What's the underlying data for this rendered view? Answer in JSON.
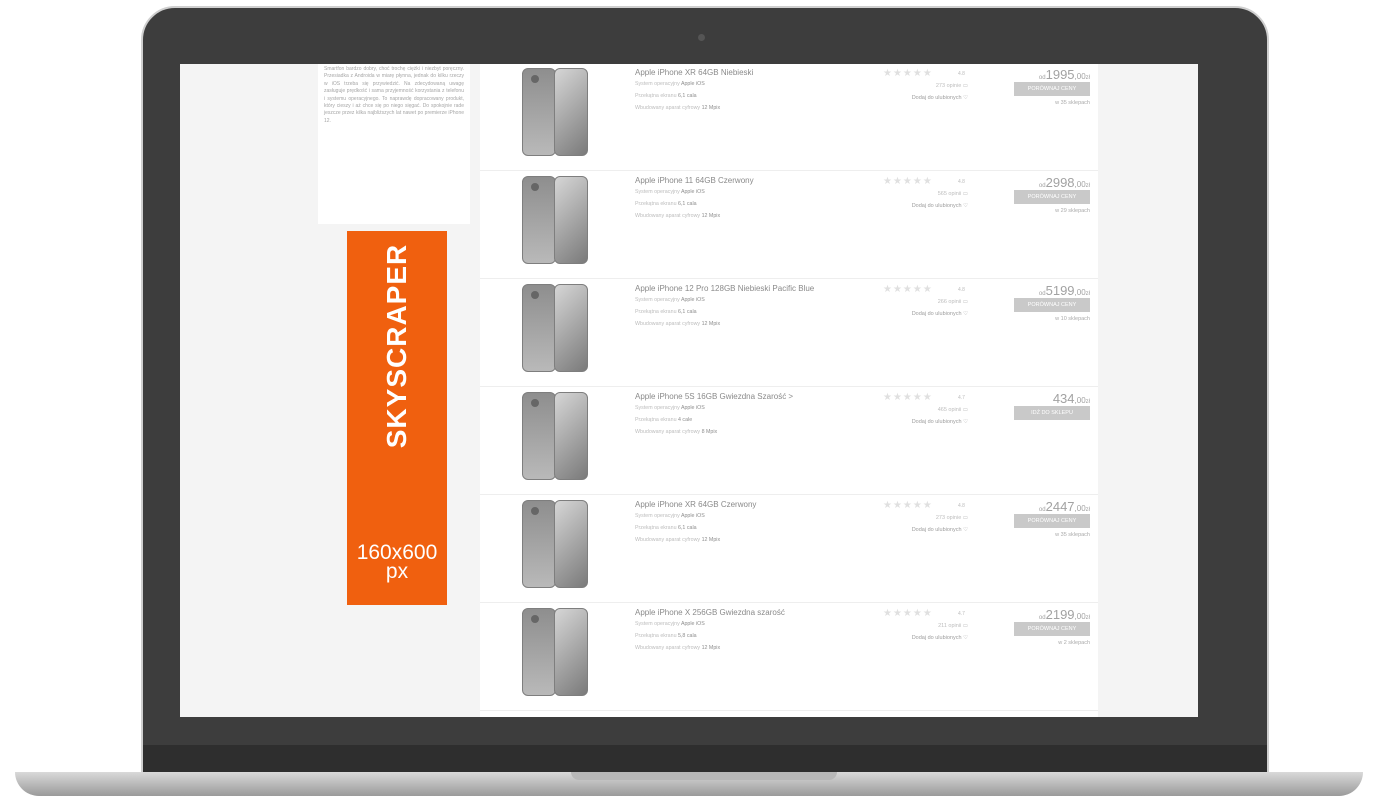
{
  "description": "Smartfon bardzo dobry, choć trochę ciężki i niezbyt poręczny. Przesiadka z Androida w miarę płynna, jednak do kilku rzeczy w iOS trzeba się przywiedzić. Na zdecydowaną uwagę zasługuje prędkość i sama przyjemność korzystania z telefonu i systemu operacyjnego. To naprawdę dopracowany produkt, który cieszy i aż chce się po niego sięgać. Do spokojnie rade jeszcze przez kilka najbliższych lat nawet po premierze iPhone 12.",
  "ad": {
    "title": "SKYSCRAPER",
    "size": "160x600",
    "unit": "px",
    "color": "#f0600f"
  },
  "labels": {
    "os": "System operacyjny",
    "screen": "Przekątna ekranu",
    "camera": "Wbudowany aparat cyfrowy",
    "favorite": "Dodaj do ulubionych"
  },
  "products": [
    {
      "name": "Apple iPhone XR 64GB Niebieski",
      "os": "Apple iOS",
      "screen": "6,1 cala",
      "camera": "12 Mpix",
      "rating": "4.8",
      "reviews": "273 opinie",
      "prefix": "od",
      "price": "1995",
      "decimals": ",00",
      "currency": "zł",
      "button": "PORÓWNAJ CENY",
      "shops": "w 35 sklepach"
    },
    {
      "name": "Apple iPhone 11 64GB Czerwony",
      "os": "Apple iOS",
      "screen": "6,1 cala",
      "camera": "12 Mpix",
      "rating": "4.8",
      "reviews": "565 opinii",
      "prefix": "od",
      "price": "2998",
      "decimals": ",00",
      "currency": "zł",
      "button": "PORÓWNAJ CENY",
      "shops": "w 29 sklepach"
    },
    {
      "name": "Apple iPhone 12 Pro 128GB Niebieski Pacific Blue",
      "os": "Apple iOS",
      "screen": "6,1 cala",
      "camera": "12 Mpix",
      "rating": "4.8",
      "reviews": "266 opinii",
      "prefix": "od",
      "price": "5199",
      "decimals": ",00",
      "currency": "zł",
      "button": "PORÓWNAJ CENY",
      "shops": "w 10 sklepach"
    },
    {
      "name": "Apple iPhone 5S 16GB Gwiezdna Szarość >",
      "os": "Apple iOS",
      "screen": "4 cale",
      "camera": "8 Mpix",
      "rating": "4.7",
      "reviews": "465 opinii",
      "prefix": "",
      "price": "434",
      "decimals": ",00",
      "currency": "zł",
      "button": "IDŹ DO SKLEPU",
      "shops": ""
    },
    {
      "name": "Apple iPhone XR 64GB Czerwony",
      "os": "Apple iOS",
      "screen": "6,1 cala",
      "camera": "12 Mpix",
      "rating": "4.8",
      "reviews": "273 opinie",
      "prefix": "od",
      "price": "2447",
      "decimals": ",00",
      "currency": "zł",
      "button": "PORÓWNAJ CENY",
      "shops": "w 35 sklepach"
    },
    {
      "name": "Apple iPhone X 256GB Gwiezdna szarość",
      "os": "Apple iOS",
      "screen": "5,8 cala",
      "camera": "12 Mpix",
      "rating": "4.7",
      "reviews": "211 opinii",
      "prefix": "od",
      "price": "2199",
      "decimals": ",00",
      "currency": "zł",
      "button": "PORÓWNAJ CENY",
      "shops": "w 2 sklepach"
    }
  ]
}
